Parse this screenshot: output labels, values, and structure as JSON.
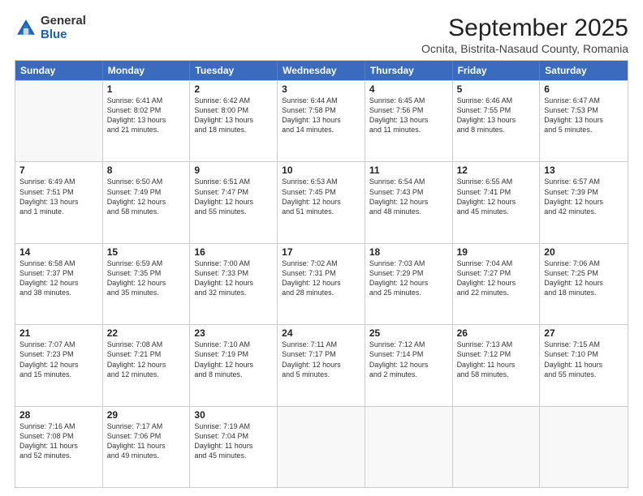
{
  "header": {
    "logo_general": "General",
    "logo_blue": "Blue",
    "title": "September 2025",
    "subtitle": "Ocnita, Bistrita-Nasaud County, Romania"
  },
  "days": [
    "Sunday",
    "Monday",
    "Tuesday",
    "Wednesday",
    "Thursday",
    "Friday",
    "Saturday"
  ],
  "weeks": [
    [
      {
        "day": "",
        "lines": []
      },
      {
        "day": "1",
        "lines": [
          "Sunrise: 6:41 AM",
          "Sunset: 8:02 PM",
          "Daylight: 13 hours",
          "and 21 minutes."
        ]
      },
      {
        "day": "2",
        "lines": [
          "Sunrise: 6:42 AM",
          "Sunset: 8:00 PM",
          "Daylight: 13 hours",
          "and 18 minutes."
        ]
      },
      {
        "day": "3",
        "lines": [
          "Sunrise: 6:44 AM",
          "Sunset: 7:58 PM",
          "Daylight: 13 hours",
          "and 14 minutes."
        ]
      },
      {
        "day": "4",
        "lines": [
          "Sunrise: 6:45 AM",
          "Sunset: 7:56 PM",
          "Daylight: 13 hours",
          "and 11 minutes."
        ]
      },
      {
        "day": "5",
        "lines": [
          "Sunrise: 6:46 AM",
          "Sunset: 7:55 PM",
          "Daylight: 13 hours",
          "and 8 minutes."
        ]
      },
      {
        "day": "6",
        "lines": [
          "Sunrise: 6:47 AM",
          "Sunset: 7:53 PM",
          "Daylight: 13 hours",
          "and 5 minutes."
        ]
      }
    ],
    [
      {
        "day": "7",
        "lines": [
          "Sunrise: 6:49 AM",
          "Sunset: 7:51 PM",
          "Daylight: 13 hours",
          "and 1 minute."
        ]
      },
      {
        "day": "8",
        "lines": [
          "Sunrise: 6:50 AM",
          "Sunset: 7:49 PM",
          "Daylight: 12 hours",
          "and 58 minutes."
        ]
      },
      {
        "day": "9",
        "lines": [
          "Sunrise: 6:51 AM",
          "Sunset: 7:47 PM",
          "Daylight: 12 hours",
          "and 55 minutes."
        ]
      },
      {
        "day": "10",
        "lines": [
          "Sunrise: 6:53 AM",
          "Sunset: 7:45 PM",
          "Daylight: 12 hours",
          "and 51 minutes."
        ]
      },
      {
        "day": "11",
        "lines": [
          "Sunrise: 6:54 AM",
          "Sunset: 7:43 PM",
          "Daylight: 12 hours",
          "and 48 minutes."
        ]
      },
      {
        "day": "12",
        "lines": [
          "Sunrise: 6:55 AM",
          "Sunset: 7:41 PM",
          "Daylight: 12 hours",
          "and 45 minutes."
        ]
      },
      {
        "day": "13",
        "lines": [
          "Sunrise: 6:57 AM",
          "Sunset: 7:39 PM",
          "Daylight: 12 hours",
          "and 42 minutes."
        ]
      }
    ],
    [
      {
        "day": "14",
        "lines": [
          "Sunrise: 6:58 AM",
          "Sunset: 7:37 PM",
          "Daylight: 12 hours",
          "and 38 minutes."
        ]
      },
      {
        "day": "15",
        "lines": [
          "Sunrise: 6:59 AM",
          "Sunset: 7:35 PM",
          "Daylight: 12 hours",
          "and 35 minutes."
        ]
      },
      {
        "day": "16",
        "lines": [
          "Sunrise: 7:00 AM",
          "Sunset: 7:33 PM",
          "Daylight: 12 hours",
          "and 32 minutes."
        ]
      },
      {
        "day": "17",
        "lines": [
          "Sunrise: 7:02 AM",
          "Sunset: 7:31 PM",
          "Daylight: 12 hours",
          "and 28 minutes."
        ]
      },
      {
        "day": "18",
        "lines": [
          "Sunrise: 7:03 AM",
          "Sunset: 7:29 PM",
          "Daylight: 12 hours",
          "and 25 minutes."
        ]
      },
      {
        "day": "19",
        "lines": [
          "Sunrise: 7:04 AM",
          "Sunset: 7:27 PM",
          "Daylight: 12 hours",
          "and 22 minutes."
        ]
      },
      {
        "day": "20",
        "lines": [
          "Sunrise: 7:06 AM",
          "Sunset: 7:25 PM",
          "Daylight: 12 hours",
          "and 18 minutes."
        ]
      }
    ],
    [
      {
        "day": "21",
        "lines": [
          "Sunrise: 7:07 AM",
          "Sunset: 7:23 PM",
          "Daylight: 12 hours",
          "and 15 minutes."
        ]
      },
      {
        "day": "22",
        "lines": [
          "Sunrise: 7:08 AM",
          "Sunset: 7:21 PM",
          "Daylight: 12 hours",
          "and 12 minutes."
        ]
      },
      {
        "day": "23",
        "lines": [
          "Sunrise: 7:10 AM",
          "Sunset: 7:19 PM",
          "Daylight: 12 hours",
          "and 8 minutes."
        ]
      },
      {
        "day": "24",
        "lines": [
          "Sunrise: 7:11 AM",
          "Sunset: 7:17 PM",
          "Daylight: 12 hours",
          "and 5 minutes."
        ]
      },
      {
        "day": "25",
        "lines": [
          "Sunrise: 7:12 AM",
          "Sunset: 7:14 PM",
          "Daylight: 12 hours",
          "and 2 minutes."
        ]
      },
      {
        "day": "26",
        "lines": [
          "Sunrise: 7:13 AM",
          "Sunset: 7:12 PM",
          "Daylight: 11 hours",
          "and 58 minutes."
        ]
      },
      {
        "day": "27",
        "lines": [
          "Sunrise: 7:15 AM",
          "Sunset: 7:10 PM",
          "Daylight: 11 hours",
          "and 55 minutes."
        ]
      }
    ],
    [
      {
        "day": "28",
        "lines": [
          "Sunrise: 7:16 AM",
          "Sunset: 7:08 PM",
          "Daylight: 11 hours",
          "and 52 minutes."
        ]
      },
      {
        "day": "29",
        "lines": [
          "Sunrise: 7:17 AM",
          "Sunset: 7:06 PM",
          "Daylight: 11 hours",
          "and 49 minutes."
        ]
      },
      {
        "day": "30",
        "lines": [
          "Sunrise: 7:19 AM",
          "Sunset: 7:04 PM",
          "Daylight: 11 hours",
          "and 45 minutes."
        ]
      },
      {
        "day": "",
        "lines": []
      },
      {
        "day": "",
        "lines": []
      },
      {
        "day": "",
        "lines": []
      },
      {
        "day": "",
        "lines": []
      }
    ]
  ]
}
